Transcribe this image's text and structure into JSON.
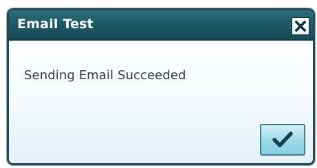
{
  "dialog": {
    "title": "Email Test",
    "message": "Sending Email Succeeded",
    "close_icon": "close-x-icon",
    "ok_icon": "checkmark-icon"
  },
  "colors": {
    "titlebar": "#1d5866",
    "border": "#1f4a55",
    "ok_button": "#9fdbe9",
    "checkmark": "#173f4a",
    "message_text": "#2c3e44"
  }
}
